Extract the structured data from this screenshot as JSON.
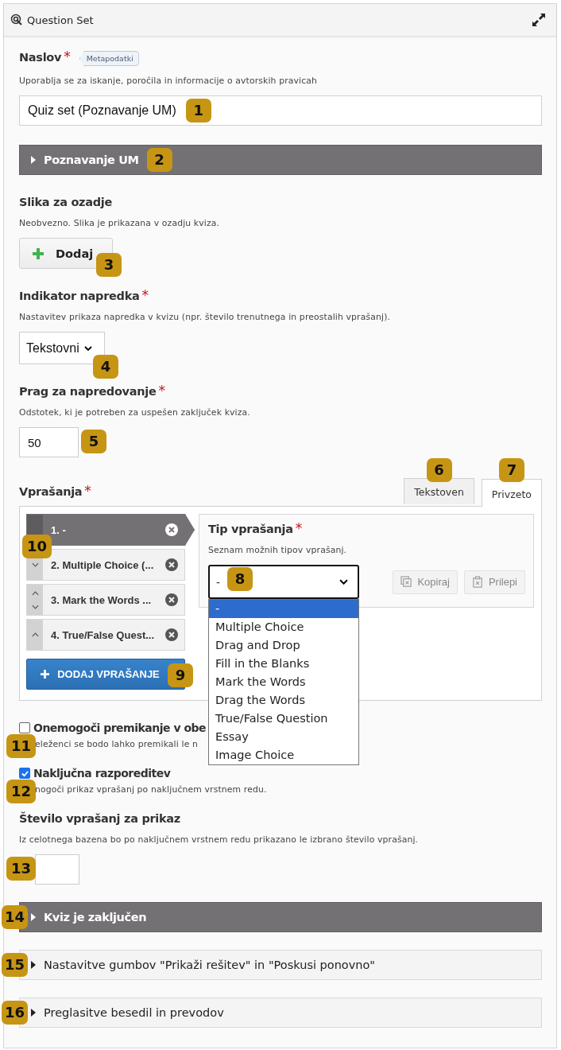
{
  "header": {
    "title": "Question Set"
  },
  "title_field": {
    "label": "Naslov",
    "required_mark": "*",
    "badge": "Metapodatki",
    "description": "Uporablja se za iskanje, poročila in informacije o avtorskih pravicah",
    "value": "Quiz set (Poznavanje UM)",
    "callout": "1"
  },
  "intro_group": {
    "label": "Poznavanje UM",
    "expanded": false,
    "callout": "2"
  },
  "background_image": {
    "label": "Slika za ozadje",
    "description": "Neobvezno. Slika je prikazana v ozadju kviza.",
    "button": "Dodaj",
    "callout": "3"
  },
  "progress_indicator": {
    "label": "Indikator napredka",
    "required_mark": "*",
    "description": "Nastavitev prikaza napredka v kvizu (npr. število trenutnega in preostalih vprašanj).",
    "value": "Tekstovni",
    "callout": "4"
  },
  "pass_percentage": {
    "label": "Prag za napredovanje",
    "required_mark": "*",
    "description": "Odstotek, ki je potreben za uspešen zaključek kviza.",
    "value": "50",
    "callout": "5"
  },
  "questions": {
    "label": "Vprašanja",
    "required_mark": "*",
    "tabs": [
      {
        "label": "Tekstoven",
        "selected": false,
        "callout": "6"
      },
      {
        "label": "Privzeto",
        "selected": true,
        "callout": "7"
      }
    ],
    "items": [
      {
        "label": "1. -",
        "selected": true,
        "can_up": false,
        "can_down": false
      },
      {
        "label": "2. Multiple Choice (...",
        "selected": false,
        "can_up": false,
        "can_down": true
      },
      {
        "label": "3. Mark the Words ...",
        "selected": false,
        "can_up": true,
        "can_down": true
      },
      {
        "label": "4. True/False Quest...",
        "selected": false,
        "can_up": true,
        "can_down": false
      }
    ],
    "items_callout": "10",
    "add_button": {
      "label": "DODAJ VPRAŠANJE",
      "callout": "9"
    },
    "editor": {
      "label": "Tip vprašanja",
      "required_mark": "*",
      "description": "Seznam možnih tipov vprašanj.",
      "select": {
        "value": "-",
        "callout": "8",
        "expanded": true,
        "options": [
          {
            "label": "-",
            "selected": true
          },
          {
            "label": "Multiple Choice",
            "selected": false
          },
          {
            "label": "Drag and Drop",
            "selected": false
          },
          {
            "label": "Fill in the Blanks",
            "selected": false
          },
          {
            "label": "Mark the Words",
            "selected": false
          },
          {
            "label": "Drag the Words",
            "selected": false
          },
          {
            "label": "True/False Question",
            "selected": false
          },
          {
            "label": "Essay",
            "selected": false
          },
          {
            "label": "Image Choice",
            "selected": false
          }
        ]
      },
      "buttons": [
        {
          "label": "Kopiraj",
          "kind": "copy",
          "disabled": true
        },
        {
          "label": "Prilepi",
          "kind": "paste",
          "disabled": true
        }
      ]
    }
  },
  "disable_backwards": {
    "label": "Onemogoči premikanje v obe",
    "checked": false,
    "description": "eleženci se bodo lahko premikali le n",
    "callout": "11"
  },
  "randomize": {
    "label": "Naključna razporeditev",
    "checked": true,
    "description": "nogoči prikaz vprašanj po naključnem vrstnem redu.",
    "callout": "12"
  },
  "pool_size": {
    "label": "Število vprašanj za prikaz",
    "description": "Iz celotnega bazena bo po naključnem vrstnem redu prikazano le izbrano število vprašanj.",
    "callout": "13"
  },
  "groups": [
    {
      "label": "Kviz je zaključen",
      "highlighted": true,
      "expanded": false,
      "callout": "14"
    },
    {
      "label": "Nastavitve gumbov \"Prikaži rešitev\" in \"Poskusi ponovno\"",
      "highlighted": false,
      "expanded": false,
      "callout": "15"
    },
    {
      "label": "Preglasitve besedil in prevodov",
      "highlighted": false,
      "expanded": false,
      "callout": "16"
    }
  ]
}
